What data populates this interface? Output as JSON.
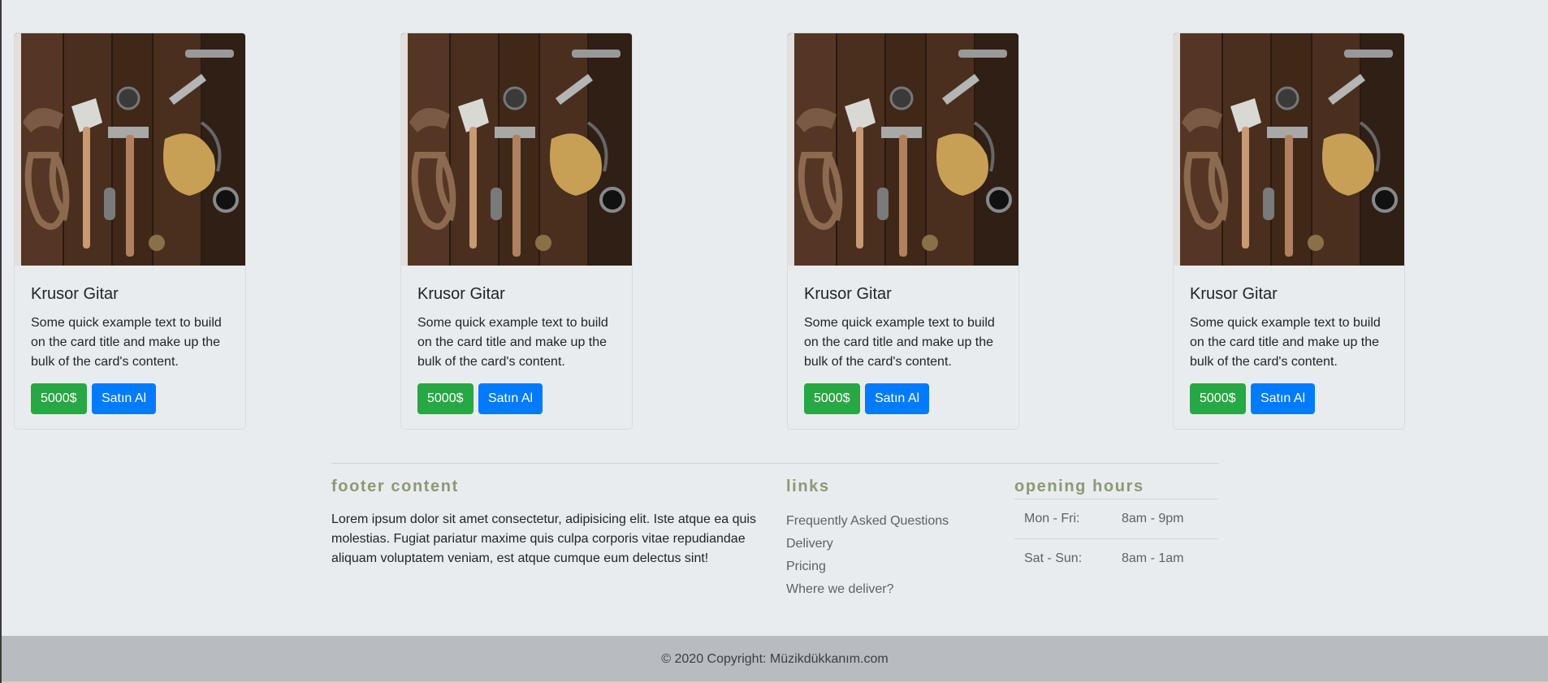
{
  "products": [
    {
      "title": "Krusor Gitar",
      "text": "Some quick example text to build on the card title and make up the bulk of the card's content.",
      "price": "5000$",
      "buy": "Satın Al"
    },
    {
      "title": "Krusor Gitar",
      "text": "Some quick example text to build on the card title and make up the bulk of the card's content.",
      "price": "5000$",
      "buy": "Satın Al"
    },
    {
      "title": "Krusor Gitar",
      "text": "Some quick example text to build on the card title and make up the bulk of the card's content.",
      "price": "5000$",
      "buy": "Satın Al"
    },
    {
      "title": "Krusor Gitar",
      "text": "Some quick example text to build on the card title and make up the bulk of the card's content.",
      "price": "5000$",
      "buy": "Satın Al"
    }
  ],
  "footer": {
    "about_heading": "footer content",
    "about_text": "Lorem ipsum dolor sit amet consectetur, adipisicing elit. Iste atque ea quis molestias. Fugiat pariatur maxime quis culpa corporis vitae repudiandae aliquam voluptatem veniam, est atque cumque eum delectus sint!",
    "links_heading": "links",
    "links": [
      "Frequently Asked Questions",
      "Delivery",
      "Pricing",
      "Where we deliver?"
    ],
    "hours_heading": "opening hours",
    "hours": [
      {
        "day": "Mon - Fri:",
        "time": "8am - 9pm"
      },
      {
        "day": "Sat - Sun:",
        "time": "8am - 1am"
      }
    ],
    "copyright": "© 2020 Copyright: Müzikdükkanım.com"
  },
  "colors": {
    "page_bg": "#e9ecef",
    "price_button": "#28a745",
    "buy_button": "#007bff",
    "footer_heading": "#8a9a72",
    "bottom_bar": "#b8bcc0"
  },
  "icons": {
    "card_image": "tools-flat-lay-photo"
  }
}
